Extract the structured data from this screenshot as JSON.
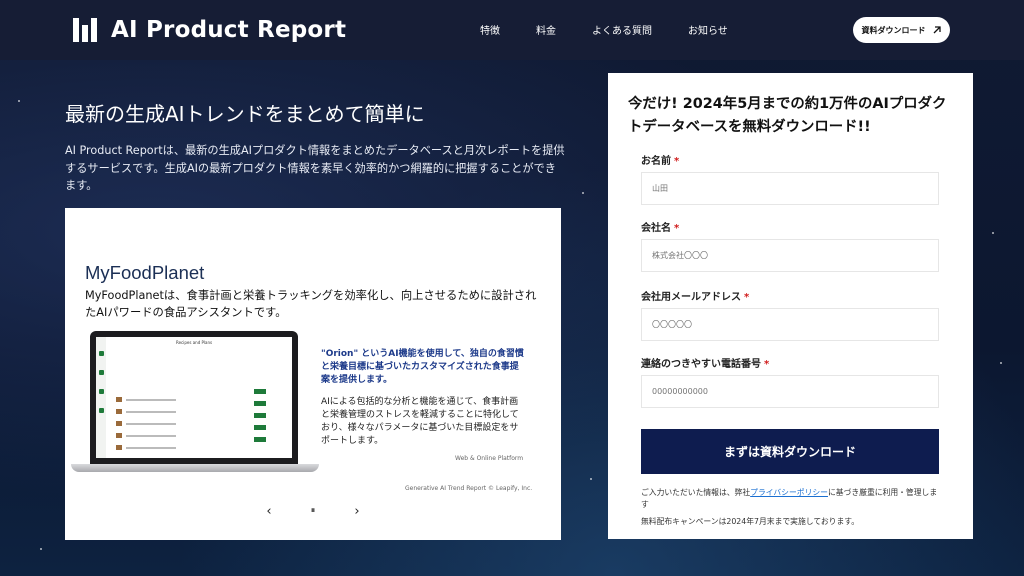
{
  "header": {
    "logo_text": "AI Product Report",
    "nav": [
      "特徴",
      "料金",
      "よくある質問",
      "お知らせ"
    ],
    "download_button": "資料ダウンロード"
  },
  "hero": {
    "title": "最新の生成AIトレンドをまとめて簡単に",
    "description": "AI Product Reportは、最新の生成AIプロダクト情報をまとめたデータベースと月次レポートを提供するサービスです。生成AIの最新プロダクト情報を素早く効率的かつ網羅的に把握することができます。"
  },
  "slide": {
    "title": "MyFoodPlanet",
    "description": "MyFoodPlanetは、食事計画と栄養トラッキングを効率化し、向上させるために設計されたAIパワードの食品アシスタントです。",
    "screen_title": "Recipes and Plans",
    "note1": "\"Orion\" というAI機能を使用して、独自の食習慣と栄養目標に基づいたカスタマイズされた食事提案を提供します。",
    "note2": "AIによる包括的な分析と機能を通じて、食事計画と栄養管理のストレスを軽減することに特化しており、様々なパラメータに基づいた目標設定をサポートします。",
    "platform": "Web & Online Platform",
    "credit": "Generative AI Trend Report © Leapify, Inc.",
    "controls": {
      "prev": "‹",
      "pause": "⏸",
      "next": "›"
    }
  },
  "form": {
    "title": "今だけ! 2024年5月までの約1万件のAIプロダクトデータベースを無料ダウンロード!!",
    "required_mark": "*",
    "fields": [
      {
        "label": "お名前",
        "placeholder": "山田"
      },
      {
        "label": "会社名",
        "placeholder": "株式会社〇〇〇"
      },
      {
        "label": "会社用メールアドレス",
        "placeholder": "〇〇〇〇〇"
      },
      {
        "label": "連絡のつきやすい電話番号",
        "placeholder": "00000000000"
      }
    ],
    "submit": "まずは資料ダウンロード",
    "privacy_before": "ご入力いただいた情報は、弊社",
    "privacy_link": "プライバシーポリシー",
    "privacy_after": "に基づき厳重に利用・管理します",
    "campaign": "無料配布キャンペーンは2024年7月末まで実施しております。"
  }
}
